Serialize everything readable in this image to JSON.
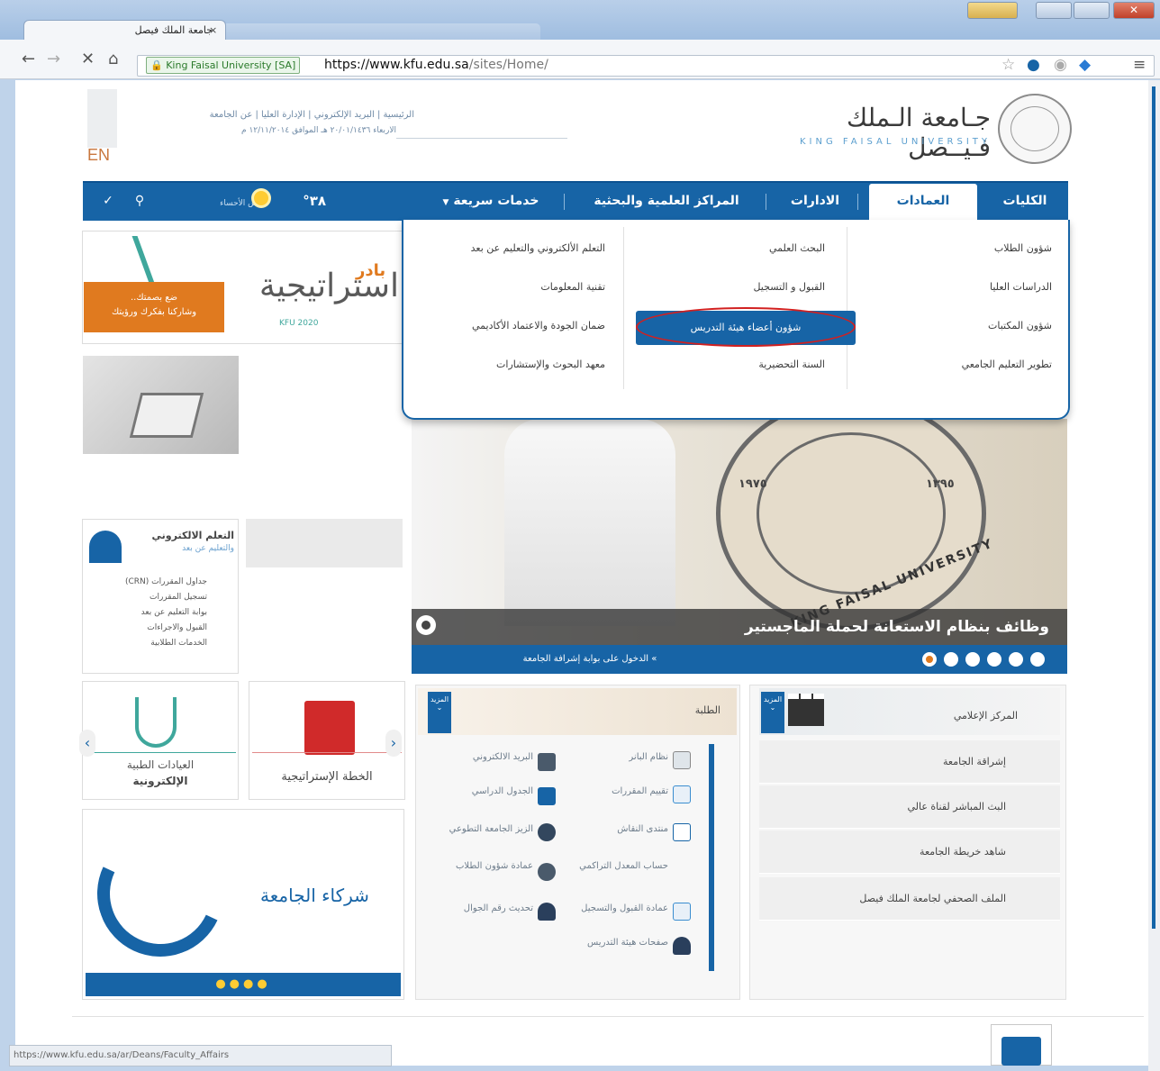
{
  "browser": {
    "tab_title": "جامعة الملك فيصل",
    "tab_close": "×",
    "secure_label": "King Faisal University [SA]",
    "url_host": "https://www.kfu.edu.sa",
    "url_path": "/sites/Home/",
    "status_url": "https://www.kfu.edu.sa/ar/Deans/Faculty_Affairs"
  },
  "header": {
    "lang_switch": "EN",
    "top_links": "الرئيسية | البريد الإلكتروني | الإدارة العليا | عن الجامعة",
    "date": "الاربعاء ٢٠/٠١/١٤٣٦ هـ الموافق ١٢/١١/٢٠١٤ م",
    "logo_ar": "جـامعة الـملك فـيــصل",
    "logo_en": "KING FAISAL UNIVERSITY"
  },
  "nav": {
    "items": [
      "الكليات",
      "العمادات",
      "الادارات",
      "المراكز العلمية والبحثية",
      "خدمات سريعة"
    ],
    "weather_label": "طقس الأحساء",
    "temperature": "٣٨°",
    "quick_services_caret": "▼"
  },
  "dropdown": {
    "col_right": [
      "شؤون الطلاب",
      "الدراسات العليا",
      "شؤون المكتبات",
      "تطوير التعليم الجامعي"
    ],
    "col_middle": [
      "البحث العلمي",
      "القبول و التسجيل",
      "شؤون أعضاء هيئة التدريس",
      "السنة التحضيرية"
    ],
    "col_left": [
      "التعلم الألكتروني والتعليم عن بعد",
      "تقنية المعلومات",
      "ضمان الجودة والاعتماد الأكاديمي",
      "معهد البحوث والإستشارات"
    ],
    "highlighted": "شؤون أعضاء هيئة التدريس"
  },
  "promo": {
    "badir": "بادر",
    "title": "استراتيجية",
    "kfu": "KFU 2020",
    "cta_line1": "ضع بصمتك..",
    "cta_line2": "وشاركنا بفكرك ورؤيتك"
  },
  "elearning": {
    "title": "التعلم الالكتروني",
    "subtitle": "والتعليم عن بعد",
    "links": [
      "جداول المقررات (CRN)",
      "تسجيل المقررات",
      "بوابة التعليم عن بعد",
      "القبول والاجراءات",
      "الخدمات الطلابية"
    ]
  },
  "cards": {
    "clinics_line1": "العيادات الطبية",
    "clinics_line2": "الإلكترونية",
    "strategy": "الخطة الإستراتيجية",
    "partners": "شركاء الجامعة",
    "prev": "‹",
    "next": "›"
  },
  "slider": {
    "caption": "وظائف بنظام الاستعانة لحملة الماجستير",
    "portal_link": "» الدخول على بوابة إشرافة الجامعة",
    "year_h": "١٣٩٥",
    "year_g": "١٩٧٥",
    "seal_text": "KING FAISAL UNIVERSITY"
  },
  "students": {
    "title": "الطلبة",
    "more": "المزيد",
    "items_right": [
      "نظام البانر",
      "تقييم المقررات",
      "منتدى النقاش",
      "حساب المعدل التراكمي",
      "عمادة القبول والتسجيل",
      "صفحات هيئة التدريس"
    ],
    "items_left": [
      "البريد الالكتروني",
      "الجدول الدراسي",
      "الزيز الجامعة التطوعي",
      "عمادة شؤون الطلاب",
      "تحديث رقم الجوال"
    ]
  },
  "media": {
    "title": "المركز الإعلامي",
    "more": "المزيد",
    "items": [
      "إشراقة الجامعة",
      "البث المباشر لقناة عالي",
      "شاهد خريطة الجامعة",
      "الملف الصحفي لجامعة الملك فيصل"
    ]
  },
  "colors": {
    "primary": "#1764a6",
    "accent_orange": "#e07a1f",
    "accent_teal": "#3fa79c",
    "highlight_ring": "#d12020"
  }
}
